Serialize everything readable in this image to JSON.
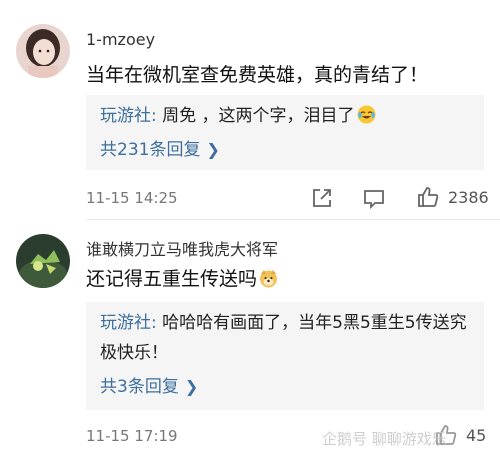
{
  "comments": [
    {
      "username": "1-mzoey",
      "text": "当年在微机室查免费英雄，真的青结了！",
      "reply": {
        "author": "玩游社:",
        "text": " 周免 ，这两个字，泪目了",
        "emoji": "crying-laughing-emoji",
        "more": "共231条回复"
      },
      "time": "11-15 14:25",
      "likes": "2386"
    },
    {
      "username": "谁敢横刀立马唯我虎大将军",
      "text": "还记得五重生传送吗",
      "text_emoji": "doge-emoji",
      "reply": {
        "author": "玩游社:",
        "text": " 哈哈哈有画面了，当年5黑5重生5传送究极快乐！",
        "more": "共3条回复"
      },
      "time": "11-15 17:19",
      "likes": "45"
    }
  ],
  "watermark": "企鹅号 聊聊游戏乐"
}
